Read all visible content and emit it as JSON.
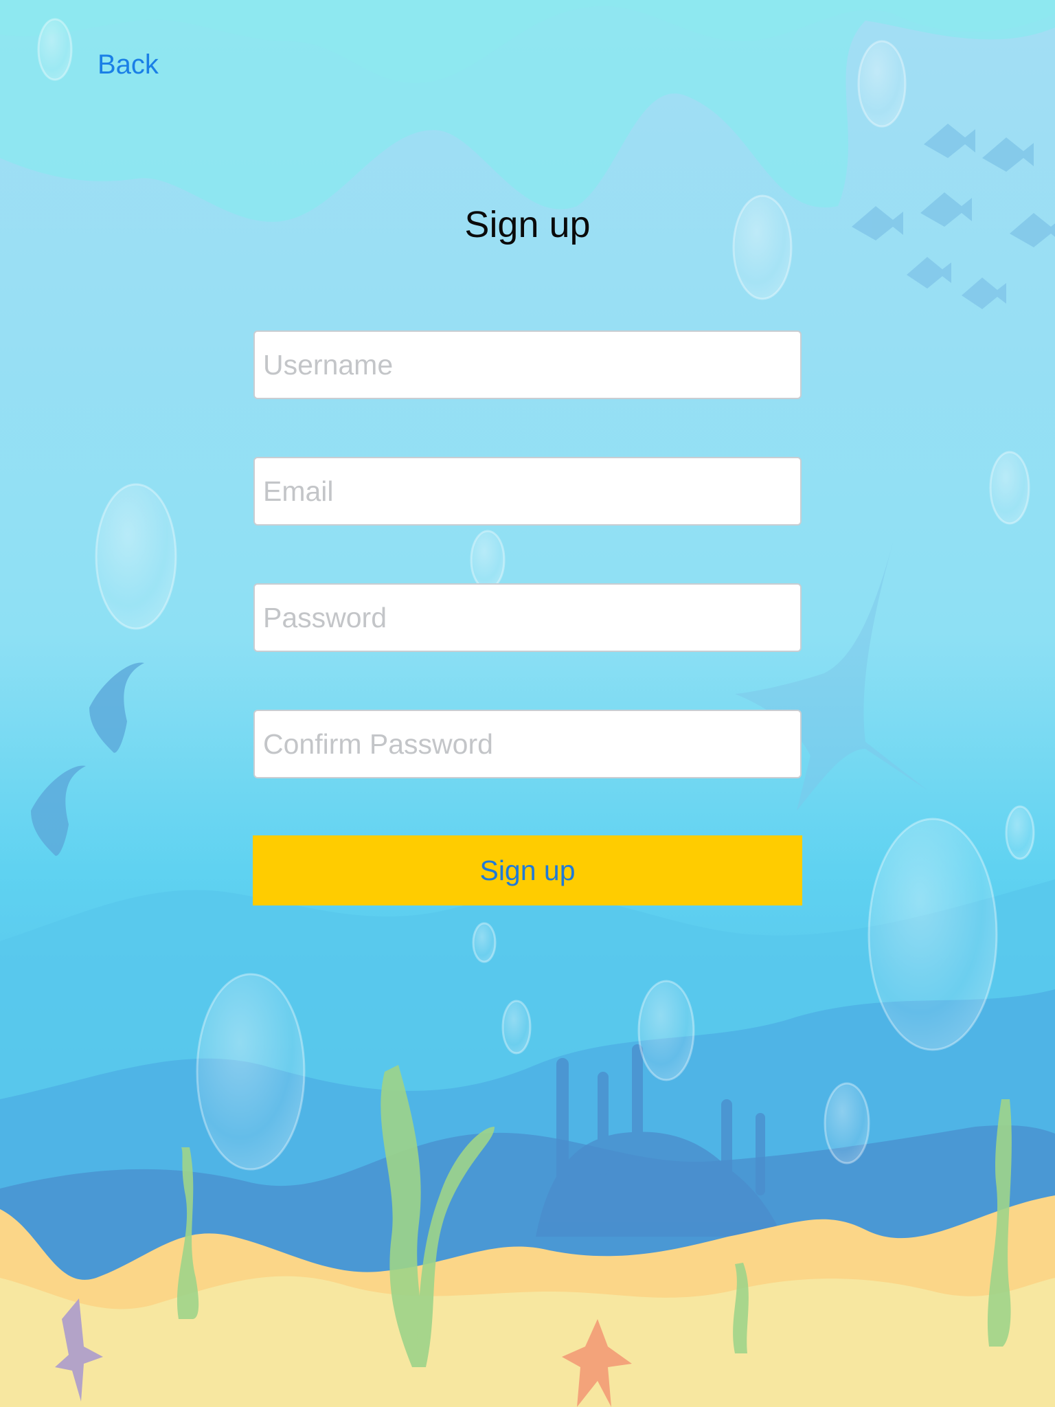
{
  "nav": {
    "back_label": "Back"
  },
  "page": {
    "title": "Sign up"
  },
  "form": {
    "username_placeholder": "Username",
    "email_placeholder": "Email",
    "password_placeholder": "Password",
    "confirm_placeholder": "Confirm Password",
    "submit_label": "Sign up"
  },
  "colors": {
    "sky_top": "#9fdff3",
    "water_mid": "#5fd0ef",
    "water_deep": "#3f8ed0",
    "sand": "#f7e7a0",
    "sand_edge": "#fbd688",
    "button_bg": "#ffcc00",
    "link": "#1a7fe6"
  }
}
